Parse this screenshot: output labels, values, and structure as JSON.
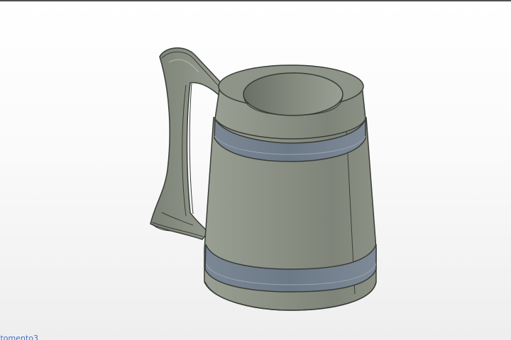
{
  "viewport": {
    "model_name": "tankard",
    "colors": {
      "background_top": "#ffffff",
      "background_bottom": "#eeeeee",
      "body": "#8e9487",
      "body_shadow": "#6d7268",
      "band": "#6f7d8c",
      "edge": "#3a3d38"
    }
  },
  "footer": {
    "link_text": "...tomento3"
  }
}
